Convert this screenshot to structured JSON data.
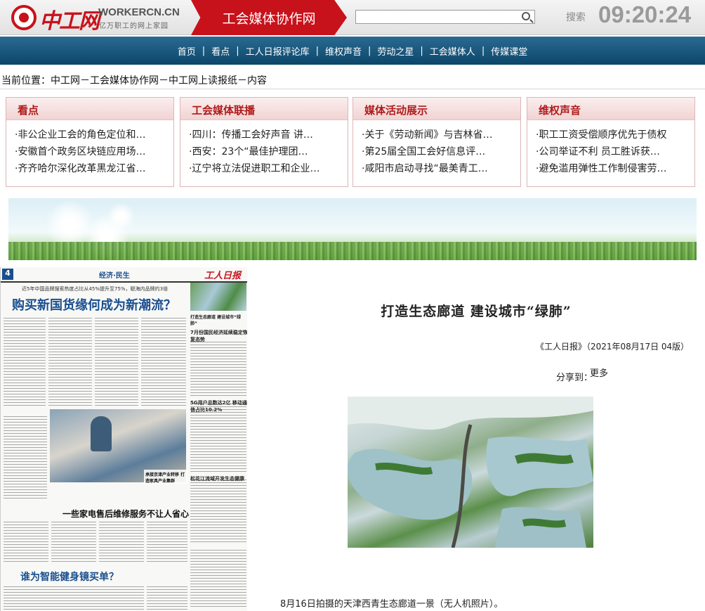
{
  "header": {
    "logo_cn": "中工网",
    "logo_en": "WORKERCN.CN",
    "logo_slogan": "亿万职工的网上家园",
    "channel_title": "工会媒体协作网",
    "search_label": "搜索",
    "clock": "09:20:24"
  },
  "nav": {
    "items": [
      "首页",
      "看点",
      "工人日报评论库",
      "维权声音",
      "劳动之星",
      "工会媒体人",
      "传媒课堂"
    ]
  },
  "breadcrumb": "当前位置：中工网－工会媒体协作网－中工网上读报纸－内容",
  "boxes": [
    {
      "title": "看点",
      "items": [
        "·非公企业工会的角色定位和…",
        "·安徽首个政务区块链应用场…",
        "·齐齐哈尔深化改革黑龙江省…"
      ]
    },
    {
      "title": "工会媒体联播",
      "items": [
        "·四川：传播工会好声音 讲…",
        "·西安：23个“最佳护理团…",
        "·辽宁将立法促进职工和企业…"
      ]
    },
    {
      "title": "媒体活动展示",
      "items": [
        "·关于《劳动新闻》与吉林省…",
        "·第25届全国工会好信息评…",
        "·咸阳市启动寻找“最美青工…"
      ]
    },
    {
      "title": "维权声音",
      "items": [
        "·职工工资受偿顺序优先于债权",
        "·公司举证不利 员工胜诉获…",
        "·避免滥用弹性工作制侵害劳…"
      ]
    }
  ],
  "newspaper": {
    "page_no": "4",
    "section": "经济·民生",
    "brand": "工人日报",
    "subhead": "近5年中国品牌搜索热度占比从45%提升至75%，聪海内品牌约3倍",
    "headline_main": "购买新国货缘何成为新潮流？",
    "headline_mid": "一些家电售后维修服务不让人省心",
    "headline_bottom": "谁为智能健身镜买单？",
    "photo_caption": "承接京津产业转移 打造家具产业集群",
    "side_head1": "7月份国民经济延续稳定恢复态势",
    "side_head2": "5G用户总数达2亿 移动通信占比10.2%",
    "side_head3": "松花江流域开发生态健康",
    "wetland_caption": "打造生态廊道 建设城市“绿肺”"
  },
  "article": {
    "title": "打造生态廊道  建设城市“绿肺”",
    "source": "《工人日报》（2021年08月17日   04版）",
    "share_label": "分享到：",
    "share_more": "更多",
    "caption": "8月16日拍摄的天津西青生态廊道一景（无人机照片）。"
  }
}
